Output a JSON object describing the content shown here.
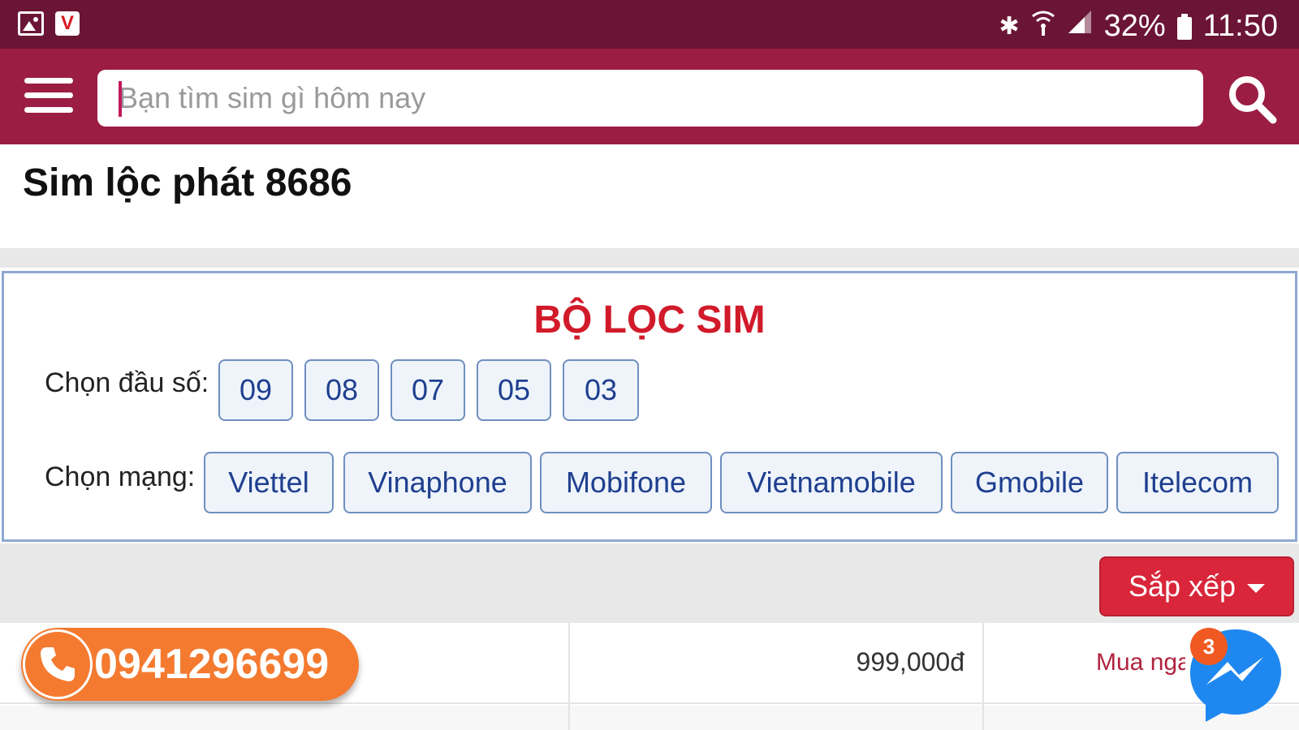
{
  "status_bar": {
    "battery": "32%",
    "time": "11:50"
  },
  "search": {
    "placeholder": "Bạn tìm sim gì hôm nay"
  },
  "page": {
    "title": "Sim lộc phát 8686"
  },
  "filter": {
    "title": "BỘ LỌC SIM",
    "prefix_label": "Chọn đầu số:",
    "prefixes": [
      "09",
      "08",
      "07",
      "05",
      "03"
    ],
    "network_label": "Chọn mạng:",
    "networks": [
      "Viettel",
      "Vinaphone",
      "Mobifone",
      "Vietnamobile",
      "Gmobile",
      "Itelecom"
    ]
  },
  "sort": {
    "label": "Sắp xếp"
  },
  "listing": {
    "phone": "0941296699",
    "price": "999,000đ",
    "buy_label": "Mua ngay"
  },
  "messenger": {
    "badge": "3"
  },
  "colors": {
    "status_bar": "#6b1535",
    "app_bar": "#9b1d44",
    "filter_title": "#d11a2a",
    "chip_text": "#1f3f8f",
    "sort_button": "#d9263a",
    "call_button": "#f47a30"
  }
}
